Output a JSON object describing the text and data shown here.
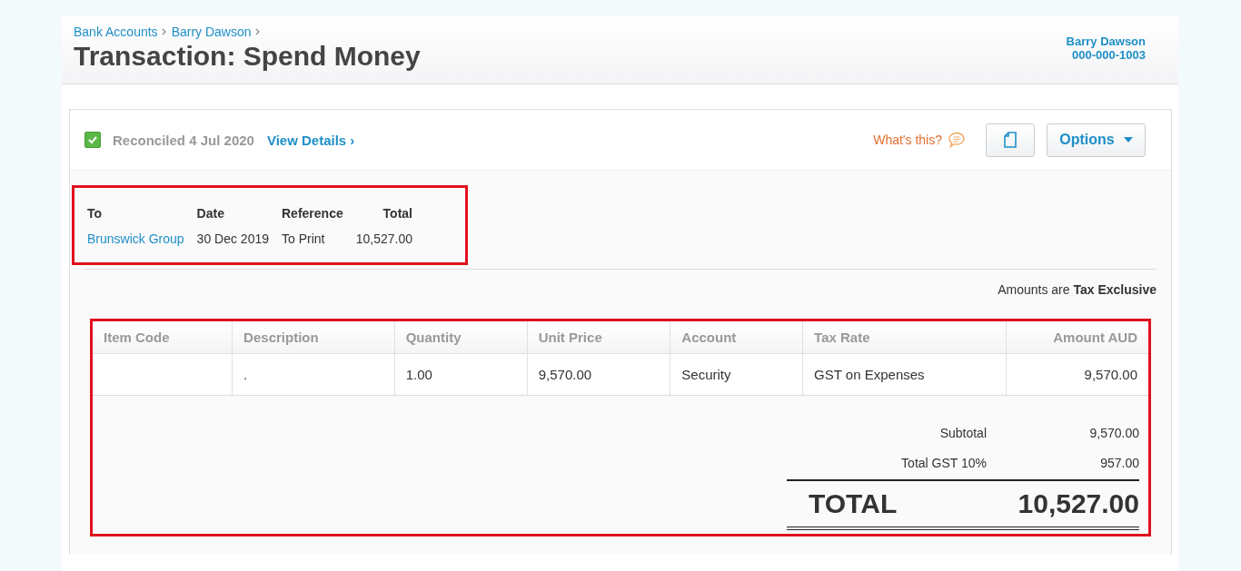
{
  "breadcrumbs": [
    "Bank Accounts",
    "Barry Dawson"
  ],
  "title": "Transaction: Spend Money",
  "account": {
    "name": "Barry Dawson",
    "number": "000-000-1003"
  },
  "status": {
    "checked": true,
    "text": "Reconciled 4 Jul 2020",
    "link": "View Details ›"
  },
  "help": "What's this?",
  "options_button": "Options",
  "summary": {
    "columns": [
      "To",
      "Date",
      "Reference",
      "Total"
    ],
    "values": [
      {
        "text": "Brunswick Group",
        "kind": "link"
      },
      {
        "text": "30 Dec 2019",
        "kind": "text"
      },
      {
        "text": "To Print",
        "kind": "text"
      },
      {
        "text": "10,527.00",
        "kind": "number"
      }
    ]
  },
  "tax_note": {
    "prefix": "Amounts are",
    "mode": "Tax Exclusive"
  },
  "table": {
    "columns": [
      "Item Code",
      "Description",
      "Quantity",
      "Unit Price",
      "Account",
      "Tax Rate",
      "Amount AUD"
    ],
    "rows": [
      [
        "",
        ".",
        "1.00",
        "9,570.00",
        "Security",
        "GST on Expenses",
        "9,570.00"
      ]
    ]
  },
  "totals": [
    {
      "label": "Subtotal",
      "value": "9,570.00"
    },
    {
      "label": "Total GST 10%",
      "value": "957.00"
    }
  ],
  "grand_total": {
    "label": "TOTAL",
    "value": "10,527.00"
  }
}
